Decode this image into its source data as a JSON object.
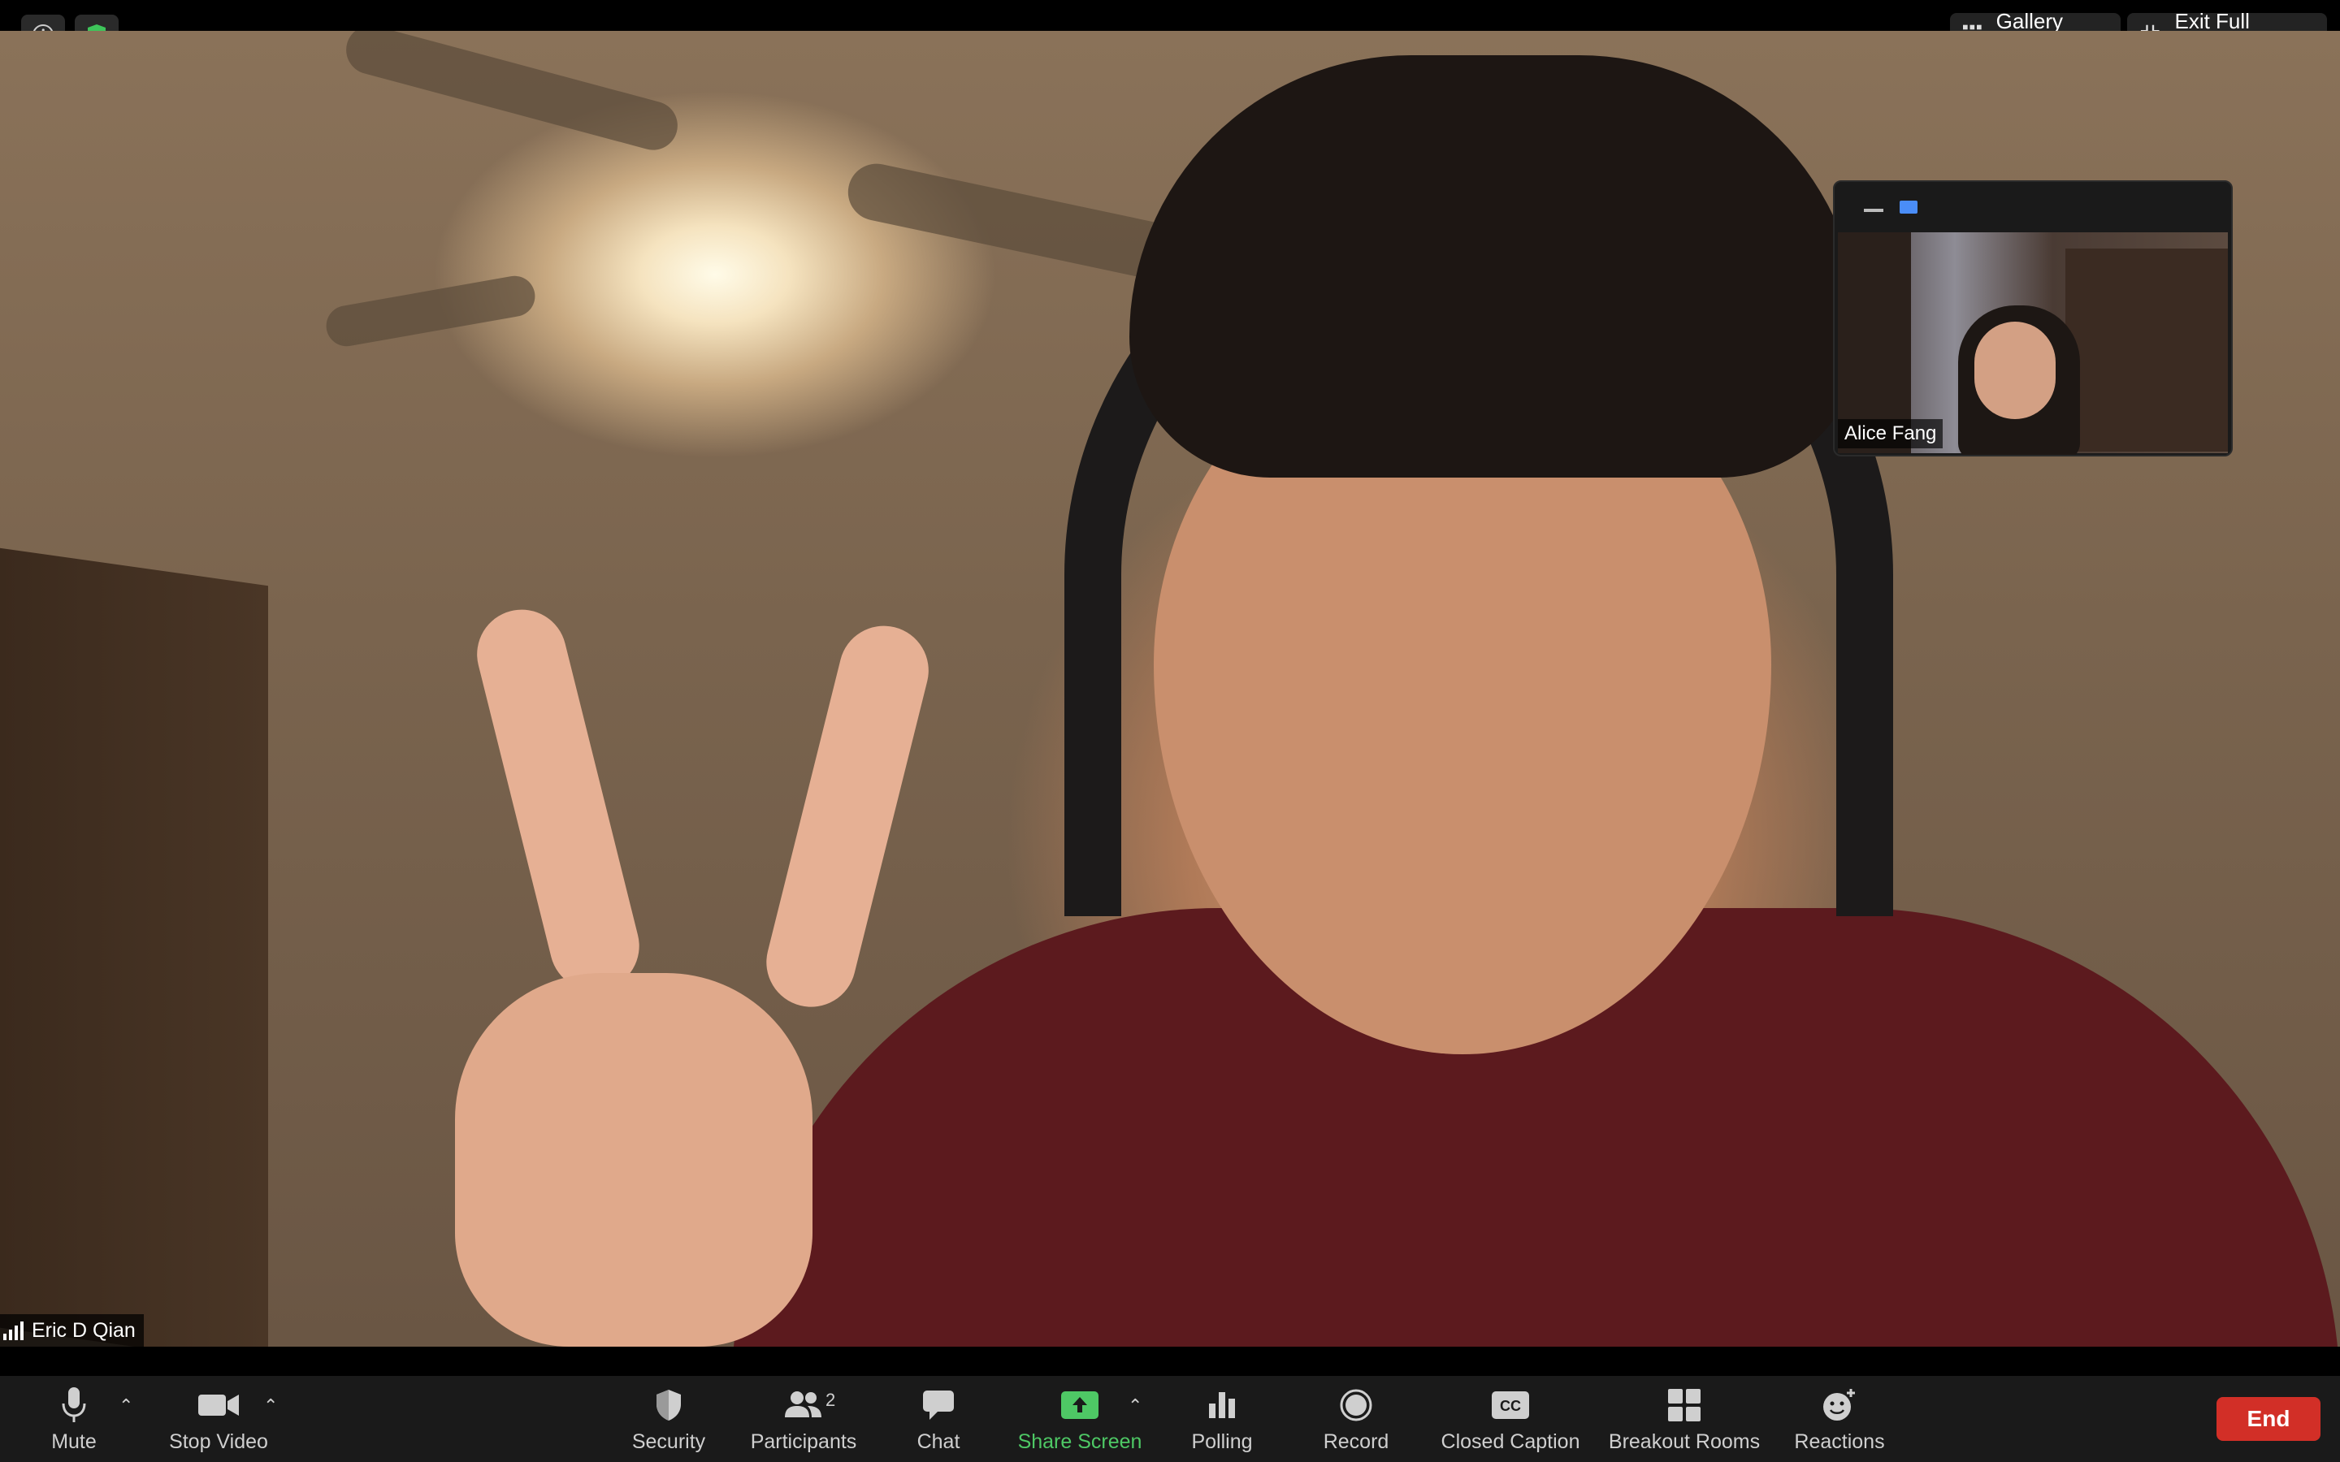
{
  "window": {
    "top_buttons": {
      "gallery_view": "Gallery View",
      "exit_full_screen": "Exit Full Screen"
    }
  },
  "main_video": {
    "speaker_name": "Eric D Qian"
  },
  "self_view": {
    "participant_name": "Alice Fang"
  },
  "toolbar": {
    "mute": "Mute",
    "stop_video": "Stop Video",
    "security": "Security",
    "participants": "Participants",
    "participants_count": "2",
    "chat": "Chat",
    "share_screen": "Share Screen",
    "polling": "Polling",
    "record": "Record",
    "closed_caption": "Closed Caption",
    "cc_icon_text": "CC",
    "breakout_rooms": "Breakout Rooms",
    "reactions": "Reactions",
    "end": "End"
  },
  "colors": {
    "share_screen_accent": "#4ec865",
    "end_button": "#d22f27",
    "shield_green": "#3ec45a",
    "toolbar_bg": "#1a1a1a"
  },
  "icons": [
    "info-icon",
    "shield-icon",
    "gallery-grid-icon",
    "exit-fullscreen-icon",
    "signal-bars-icon",
    "minimize-icon",
    "switch-view-icon",
    "microphone-icon",
    "camera-icon",
    "shield-icon",
    "participants-icon",
    "chat-icon",
    "share-screen-icon",
    "polling-icon",
    "record-icon",
    "closed-caption-icon",
    "breakout-rooms-icon",
    "reactions-icon"
  ]
}
